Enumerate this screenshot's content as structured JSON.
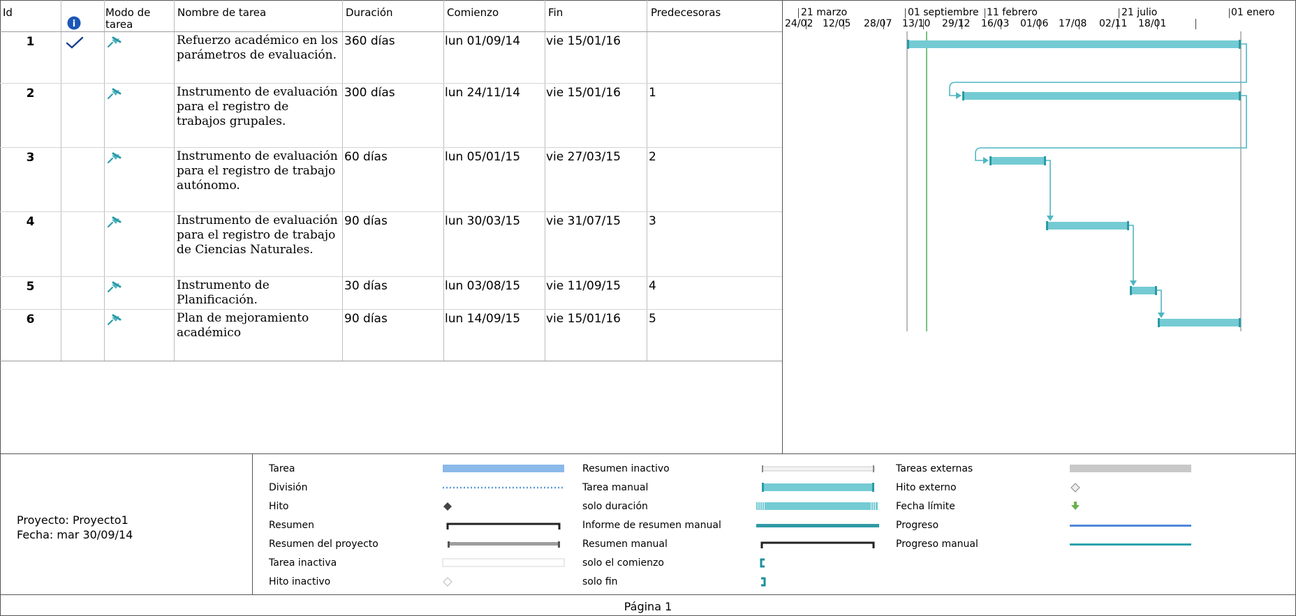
{
  "columns": {
    "id": "Id",
    "info": "i",
    "mode": "Modo de tarea",
    "name": "Nombre de tarea",
    "duration": "Duración",
    "start": "Comienzo",
    "finish": "Fin",
    "predecessors": "Predecesoras"
  },
  "timescale": {
    "top": [
      "21 marzo",
      "01 septiembre",
      "11 febrero",
      "21 julio",
      "01 enero"
    ],
    "bottom": [
      "24/02",
      "12/05",
      "28/07",
      "13/10",
      "29/12",
      "16/03",
      "01/06",
      "17/08",
      "02/11",
      "18/01"
    ]
  },
  "tasks": [
    {
      "id": "1",
      "done": true,
      "name": "Refuerzo académico en los parámetros de evaluación.",
      "duration": "360 días",
      "start": "lun 01/09/14",
      "finish": "vie 15/01/16",
      "pred": ""
    },
    {
      "id": "2",
      "done": false,
      "name": "Instrumento de evaluación para el registro de trabajos grupales.",
      "duration": "300 días",
      "start": "lun 24/11/14",
      "finish": "vie 15/01/16",
      "pred": "1"
    },
    {
      "id": "3",
      "done": false,
      "name": "Instrumento de evaluación para el registro de trabajo autónomo.",
      "duration": "60 días",
      "start": "lun 05/01/15",
      "finish": "vie 27/03/15",
      "pred": "2"
    },
    {
      "id": "4",
      "done": false,
      "name": "Instrumento de evaluación para el registro de trabajo de Ciencias Naturales.",
      "duration": "90 días",
      "start": "lun 30/03/15",
      "finish": "vie 31/07/15",
      "pred": "3"
    },
    {
      "id": "5",
      "done": false,
      "name": "Instrumento de Planificación.",
      "duration": "30 días",
      "start": "lun 03/08/15",
      "finish": "vie 11/09/15",
      "pred": "4"
    },
    {
      "id": "6",
      "done": false,
      "name": "Plan de mejoramiento académico",
      "duration": "90 días",
      "start": "lun 14/09/15",
      "finish": "vie 15/01/16",
      "pred": "5"
    }
  ],
  "footer": {
    "project": "Proyecto: Proyecto1",
    "date": "Fecha: mar 30/09/14",
    "page": "Página 1"
  },
  "legend": [
    [
      "Tarea",
      "División",
      "Hito",
      "Resumen",
      "Resumen del proyecto",
      "Tarea inactiva",
      "Hito inactivo"
    ],
    [
      "Resumen inactivo",
      "Tarea manual",
      "solo duración",
      "Informe de resumen manual",
      "Resumen manual",
      "solo el comienzo",
      "solo fin"
    ],
    [
      "Tareas externas",
      "Hito externo",
      "Fecha límite",
      "Progreso",
      "Progreso manual"
    ]
  ],
  "colors": {
    "manual_bar": "#74cbd3",
    "manual_bar_end": "#2a9aa6",
    "link": "#4fb6c2",
    "task_bar": "#8bb9ea",
    "today_line": "#4caf50",
    "progress": "#4f86d8",
    "deadline": "#6ab04c"
  },
  "icons": {
    "info_header": "info-circle-icon",
    "mode": "pushpin-manual-icon",
    "done": "checkmark-icon"
  }
}
